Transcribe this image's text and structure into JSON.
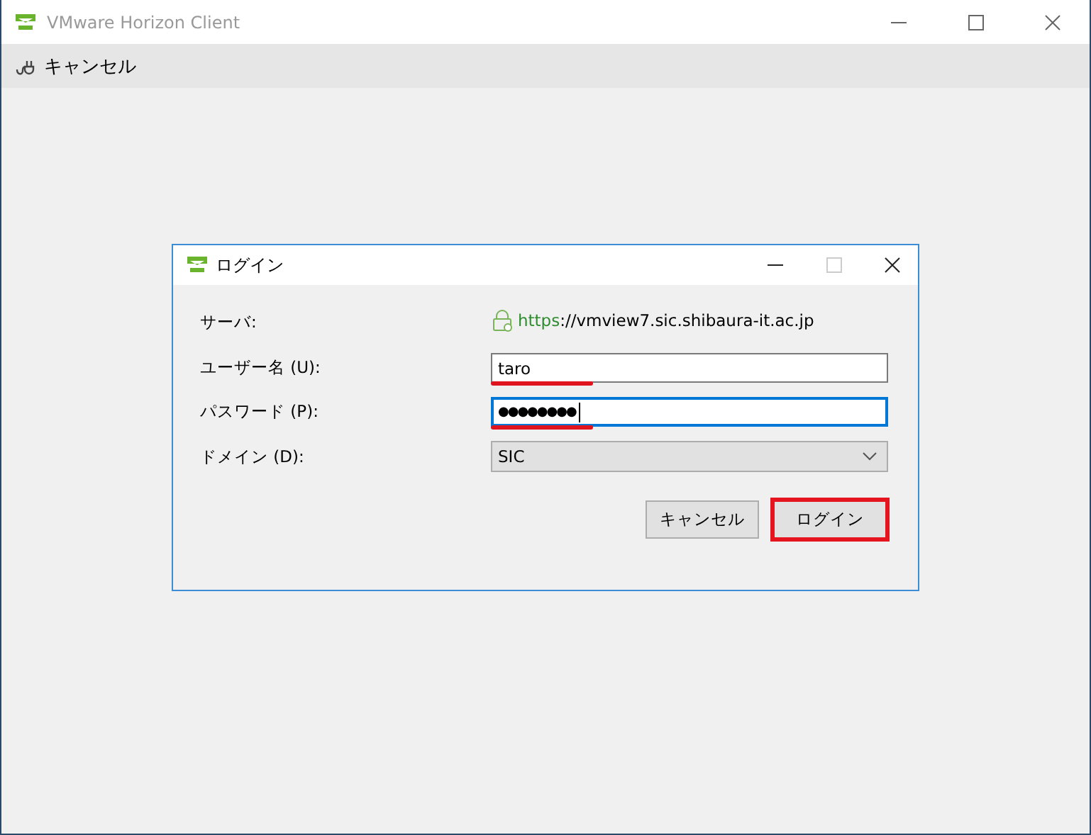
{
  "window": {
    "title": "VMware Horizon Client"
  },
  "toolbar": {
    "cancel_label": "キャンセル"
  },
  "dialog": {
    "title": "ログイン",
    "server": {
      "label": "サーバ:",
      "url_scheme": "https",
      "url_rest": "://vmview7.sic.shibaura-it.ac.jp"
    },
    "fields": [
      {
        "kind": "text",
        "label": "ユーザー名 (U):",
        "value": "taro",
        "focused": false,
        "annotated": true
      },
      {
        "kind": "password",
        "label": "パスワード (P):",
        "value": "●●●●●●●●",
        "focused": true,
        "annotated": true
      },
      {
        "kind": "select",
        "label": "ドメイン (D):",
        "value": "SIC"
      }
    ],
    "buttons": [
      {
        "label": "キャンセル",
        "highlighted": false
      },
      {
        "label": "ログイン",
        "highlighted": true
      }
    ]
  }
}
